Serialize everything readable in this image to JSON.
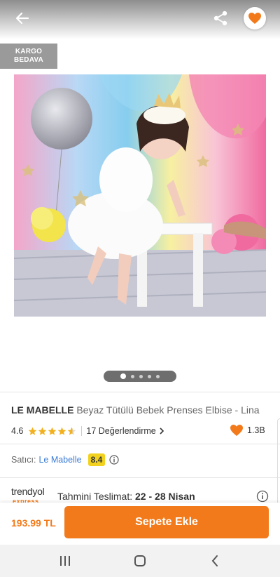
{
  "header": {
    "back_icon": "arrow-left-icon",
    "share_icon": "share-icon",
    "favorite_icon": "heart-icon",
    "favorite_color": "#f27a1a"
  },
  "badge": {
    "line1": "KARGO",
    "line2": "BEDAVA"
  },
  "gallery": {
    "image_count": 5,
    "active_index": 0
  },
  "product": {
    "brand": "LE MABELLE",
    "name": "Beyaz Tütülü Bebek Prenses Elbise - Lina",
    "rating": "4.6",
    "stars_value": 4.6,
    "reviews_label": "17 Değerlendirme",
    "likes": "1.3B"
  },
  "seller": {
    "label": "Satıcı:",
    "name": "Le Mabelle",
    "score": "8.4",
    "score_color": "#f2d21f"
  },
  "delivery": {
    "logo_text": "trendyol",
    "logo_sub": "express",
    "label": "Tahmini Teslimat:",
    "range": "22 - 28 Nisan"
  },
  "cart": {
    "price": "193.99 TL",
    "button_label": "Sepete Ekle",
    "accent": "#f27a1a"
  },
  "system_nav": {
    "recents_icon": "recents-icon",
    "home_icon": "home-icon",
    "back_icon": "chevron-left-icon"
  }
}
